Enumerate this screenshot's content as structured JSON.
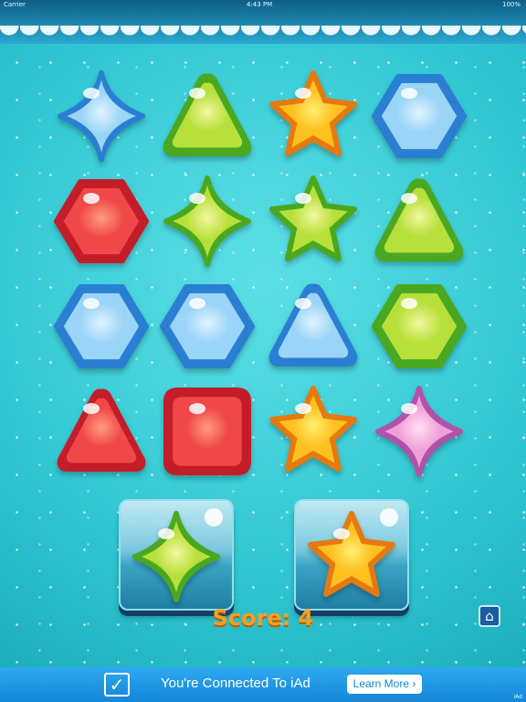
{
  "status_bar": {
    "carrier": "Carrier",
    "time": "4:43 PM",
    "battery": "100%"
  },
  "board": {
    "rows": [
      [
        {
          "shape": "diamond",
          "color": "blue"
        },
        {
          "shape": "triangle",
          "color": "green"
        },
        {
          "shape": "star",
          "color": "orange"
        },
        {
          "shape": "hexagon",
          "color": "blue"
        }
      ],
      [
        {
          "shape": "hexagon",
          "color": "red"
        },
        {
          "shape": "diamond",
          "color": "green"
        },
        {
          "shape": "star",
          "color": "green"
        },
        {
          "shape": "triangle",
          "color": "green"
        }
      ],
      [
        {
          "shape": "hexagon",
          "color": "blue"
        },
        {
          "shape": "hexagon",
          "color": "blue"
        },
        {
          "shape": "triangle",
          "color": "blue"
        },
        {
          "shape": "hexagon",
          "color": "green"
        }
      ],
      [
        {
          "shape": "triangle",
          "color": "red"
        },
        {
          "shape": "square",
          "color": "red"
        },
        {
          "shape": "star",
          "color": "orange"
        },
        {
          "shape": "diamond",
          "color": "pink"
        }
      ]
    ]
  },
  "selection": {
    "left": {
      "shape": "diamond",
      "color": "green"
    },
    "right": {
      "shape": "star",
      "color": "orange"
    }
  },
  "score": {
    "text": "Score: 4"
  },
  "home_button": {
    "icon": "home-icon"
  },
  "ad": {
    "text": "You're Connected To iAd",
    "button": "Learn More ›",
    "tag": "iAd"
  },
  "palette": {
    "blue": [
      "#2a7fd3",
      "#9ad4f7",
      "#dff3ff"
    ],
    "green": [
      "#4aa820",
      "#b8e03a",
      "#f2f7a0"
    ],
    "orange": [
      "#e47a10",
      "#ffc020",
      "#fff070"
    ],
    "red": [
      "#c41d2a",
      "#f04848",
      "#ff9a80"
    ],
    "pink": [
      "#b052a8",
      "#f0a0d8",
      "#ffe0f4"
    ]
  }
}
